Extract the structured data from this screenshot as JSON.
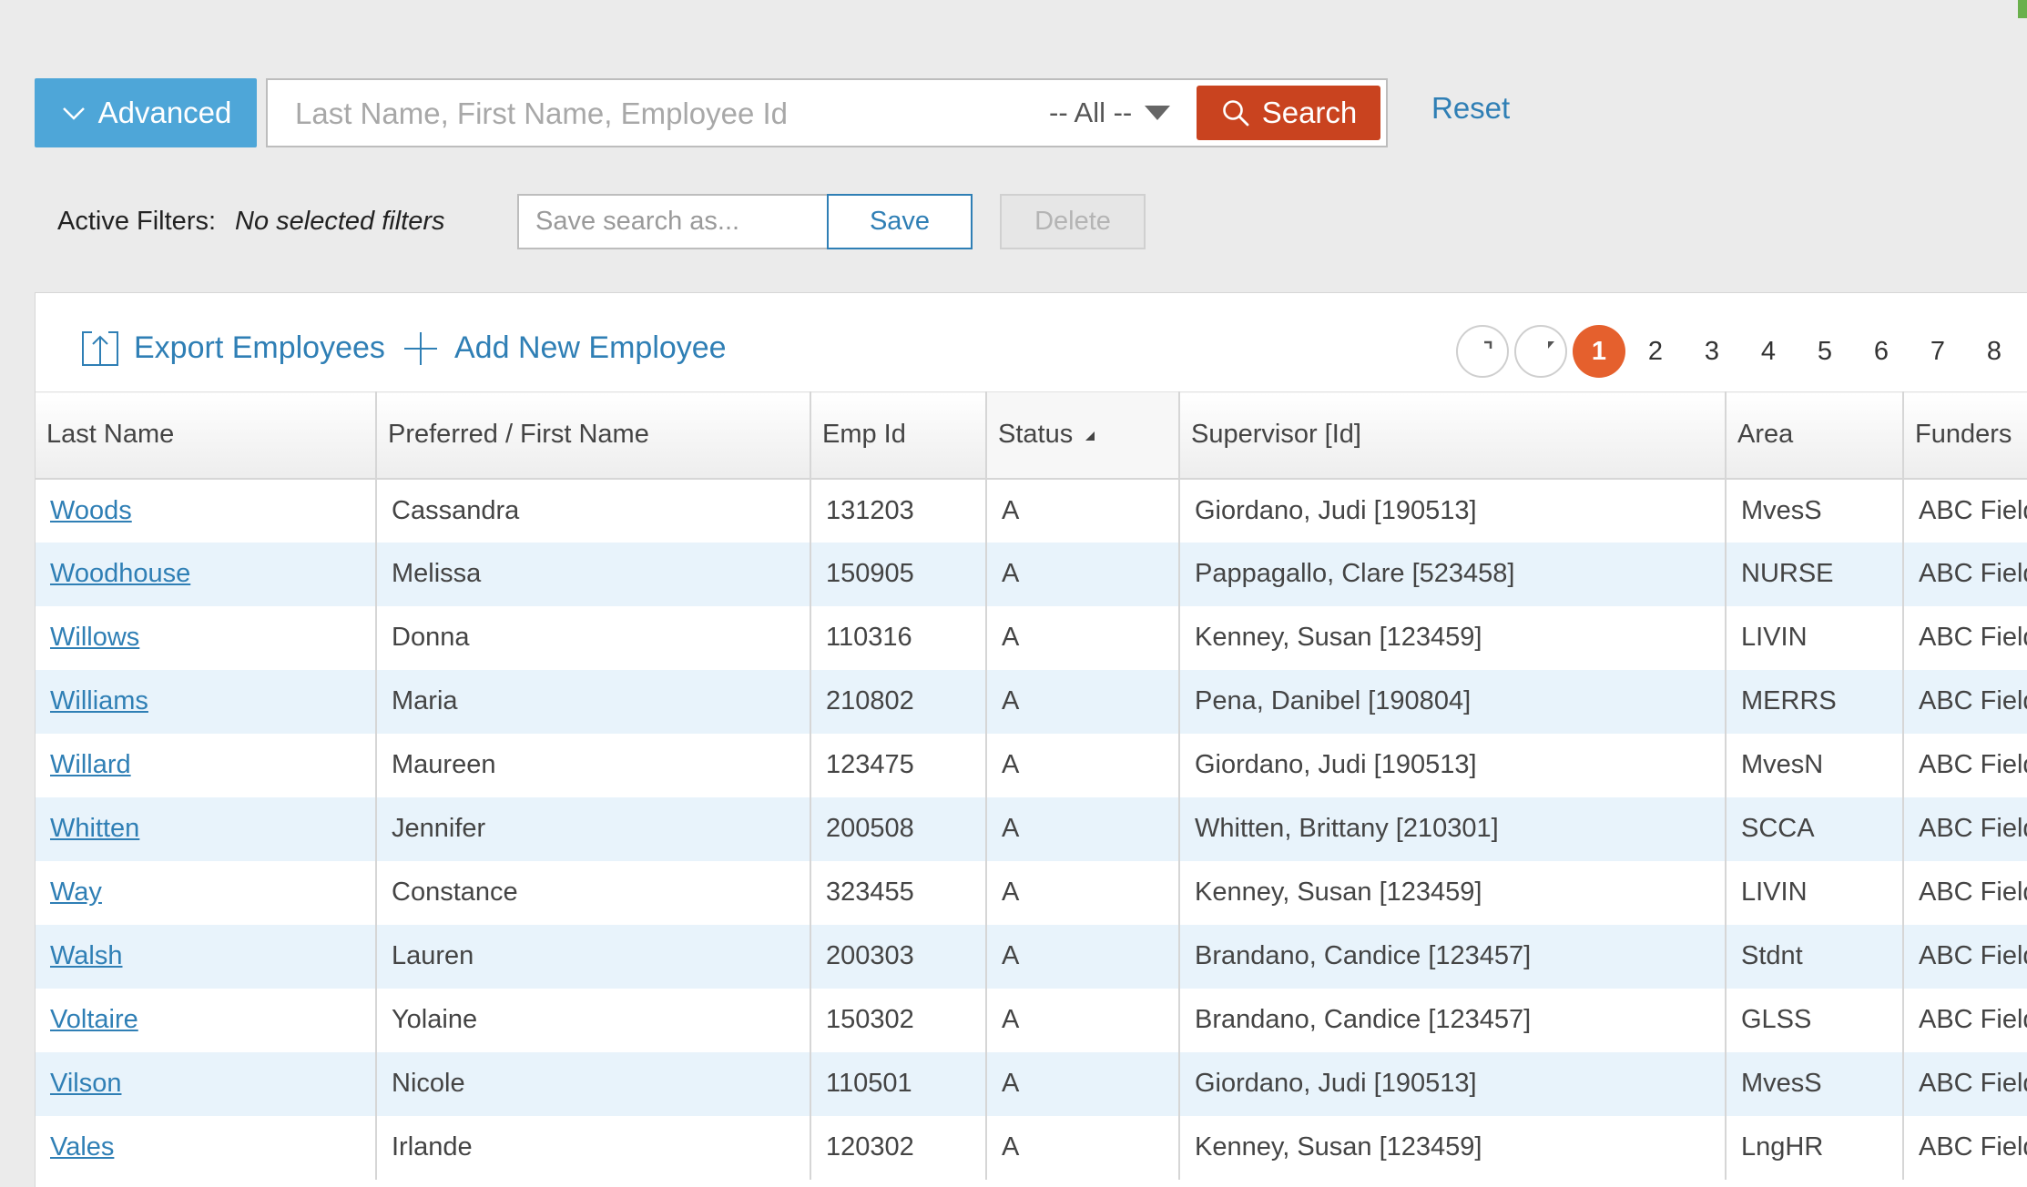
{
  "search": {
    "advanced_label": "Advanced",
    "placeholder": "Last Name, First Name, Employee Id",
    "scope_value": "-- All --",
    "search_label": "Search",
    "reset_label": "Reset"
  },
  "filters": {
    "label": "Active Filters:",
    "value": "No selected filters",
    "save_placeholder": "Save search as...",
    "save_label": "Save",
    "delete_label": "Delete"
  },
  "toolbar": {
    "export_label": "Export Employees",
    "add_label": "Add New Employee"
  },
  "pager": {
    "current": "1",
    "pages": [
      "1",
      "2",
      "3",
      "4",
      "5",
      "6",
      "7",
      "8"
    ]
  },
  "table": {
    "columns": [
      "Last Name",
      "Preferred / First Name",
      "Emp Id",
      "Status",
      "Supervisor [Id]",
      "Area",
      "Funders"
    ],
    "sorted_column": "Status",
    "rows": [
      {
        "last": "Woods",
        "first": "Cassandra",
        "id": "131203",
        "status": "A",
        "supervisor": "Giordano, Judi [190513]",
        "area": "MvesS",
        "funders": "ABC Field"
      },
      {
        "last": "Woodhouse",
        "first": "Melissa",
        "id": "150905",
        "status": "A",
        "supervisor": "Pappagallo, Clare [523458]",
        "area": "NURSE",
        "funders": "ABC Field"
      },
      {
        "last": "Willows",
        "first": "Donna",
        "id": "110316",
        "status": "A",
        "supervisor": "Kenney, Susan [123459]",
        "area": "LIVIN",
        "funders": "ABC Field"
      },
      {
        "last": "Williams",
        "first": "Maria",
        "id": "210802",
        "status": "A",
        "supervisor": "Pena, Danibel [190804]",
        "area": "MERRS",
        "funders": "ABC Field"
      },
      {
        "last": "Willard",
        "first": "Maureen",
        "id": "123475",
        "status": "A",
        "supervisor": "Giordano, Judi [190513]",
        "area": "MvesN",
        "funders": "ABC Field"
      },
      {
        "last": "Whitten",
        "first": "Jennifer",
        "id": "200508",
        "status": "A",
        "supervisor": "Whitten, Brittany [210301]",
        "area": "SCCA",
        "funders": "ABC Field"
      },
      {
        "last": "Way",
        "first": "Constance",
        "id": "323455",
        "status": "A",
        "supervisor": "Kenney, Susan [123459]",
        "area": "LIVIN",
        "funders": "ABC Field"
      },
      {
        "last": "Walsh",
        "first": "Lauren",
        "id": "200303",
        "status": "A",
        "supervisor": "Brandano, Candice [123457]",
        "area": "Stdnt",
        "funders": "ABC Field"
      },
      {
        "last": "Voltaire",
        "first": "Yolaine",
        "id": "150302",
        "status": "A",
        "supervisor": "Brandano, Candice [123457]",
        "area": "GLSS",
        "funders": "ABC Field"
      },
      {
        "last": "Vilson",
        "first": "Nicole",
        "id": "110501",
        "status": "A",
        "supervisor": "Giordano, Judi [190513]",
        "area": "MvesS",
        "funders": "ABC Field"
      },
      {
        "last": "Vales",
        "first": "Irlande",
        "id": "120302",
        "status": "A",
        "supervisor": "Kenney, Susan [123459]",
        "area": "LngHR",
        "funders": "ABC Field"
      }
    ]
  },
  "colors": {
    "accent": "#4ea6d8",
    "search_button": "#c9431f",
    "link": "#2f7fb5",
    "current_page": "#e5602d",
    "row_alt": "#e8f3fb"
  }
}
